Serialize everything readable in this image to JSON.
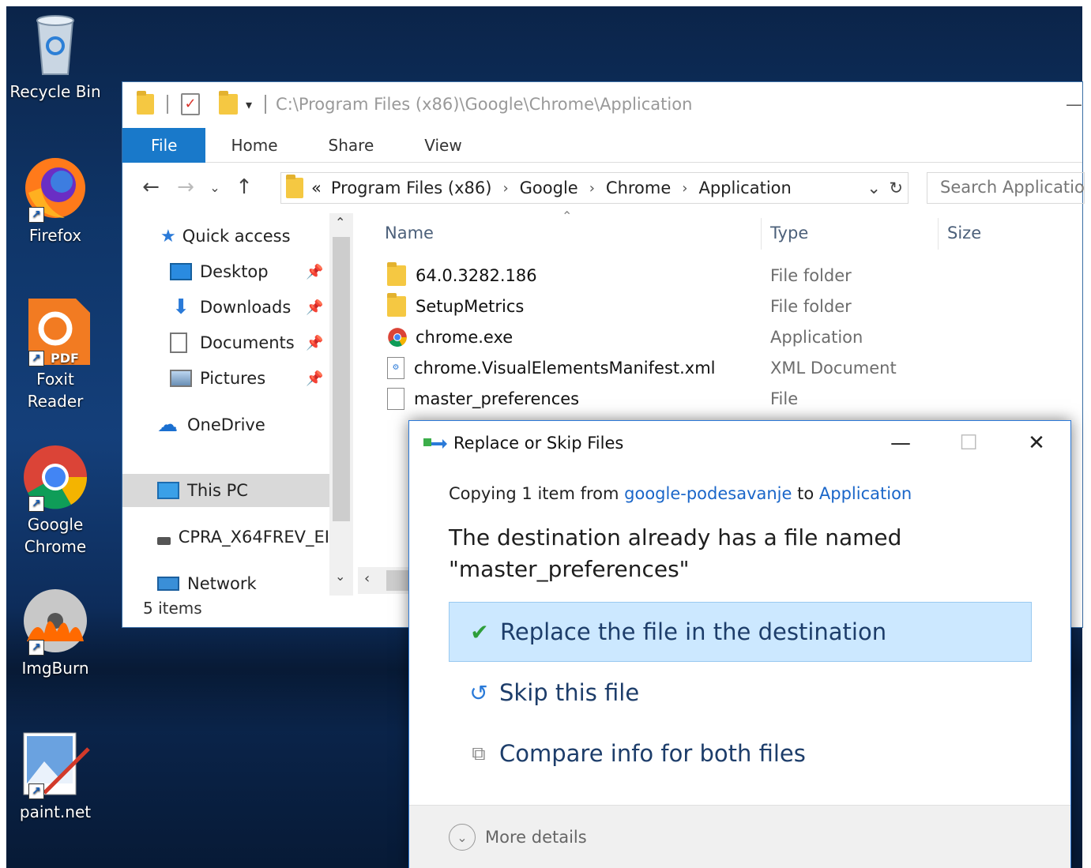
{
  "desktop": {
    "icons": [
      {
        "label": "Recycle Bin",
        "icon": "recycle-bin-icon"
      },
      {
        "label": "Firefox",
        "icon": "firefox-icon"
      },
      {
        "label": "Foxit Reader",
        "icon": "foxit-reader-icon",
        "badge": "PDF"
      },
      {
        "label": "Google Chrome",
        "icon": "chrome-icon"
      },
      {
        "label": "ImgBurn",
        "icon": "imgburn-icon"
      },
      {
        "label": "paint.net",
        "icon": "paintnet-icon"
      }
    ]
  },
  "explorer": {
    "title_path": "C:\\Program Files (x86)\\Google\\Chrome\\Application",
    "minimize": "—",
    "ribbon_tabs": [
      "File",
      "Home",
      "Share",
      "View"
    ],
    "address": {
      "overflow": "«",
      "crumbs": [
        "Program Files (x86)",
        "Google",
        "Chrome",
        "Application"
      ]
    },
    "search_placeholder": "Search Application",
    "nav": {
      "quick_access": "Quick access",
      "desktop": "Desktop",
      "downloads": "Downloads",
      "documents": "Documents",
      "pictures": "Pictures",
      "onedrive": "OneDrive",
      "this_pc": "This PC",
      "drive": "CPRA_X64FREV_EI",
      "network": "Network"
    },
    "columns": {
      "name": "Name",
      "type": "Type",
      "size": "Size"
    },
    "files": [
      {
        "name": "64.0.3282.186",
        "type": "File folder",
        "icon": "folder-icon"
      },
      {
        "name": "SetupMetrics",
        "type": "File folder",
        "icon": "folder-icon"
      },
      {
        "name": "chrome.exe",
        "type": "Application",
        "icon": "chrome-icon"
      },
      {
        "name": "chrome.VisualElementsManifest.xml",
        "type": "XML Document",
        "icon": "xml-file-icon"
      },
      {
        "name": "master_preferences",
        "type": "File",
        "icon": "file-icon"
      }
    ],
    "status": "5 items"
  },
  "dialog": {
    "title": "Replace or Skip Files",
    "copy_prefix": "Copying 1 item from",
    "source": "google-podesavanje",
    "copy_to": "to",
    "destination": "Application",
    "message": "The destination already has a file named \"master_preferences\"",
    "options": {
      "replace": "Replace the file in the destination",
      "skip": "Skip this file",
      "compare": "Compare info for both files"
    },
    "more_details": "More details"
  },
  "colors": {
    "accent": "#1979ca",
    "selected_option": "#cce8ff",
    "link": "#1a66c9"
  }
}
